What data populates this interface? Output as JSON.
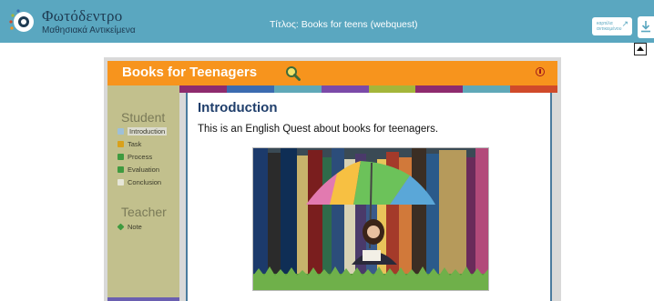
{
  "header": {
    "brand_name": "Φωτόδεντρο",
    "brand_sub": "Μαθησιακά Αντικείμενα",
    "title": "Τίτλος: Books for teens (webquest)",
    "open_button_line1": "καρτέλα",
    "open_button_line2": "αντικειμένου"
  },
  "webquest": {
    "title": "Books for Teenagers",
    "student_heading": "Student",
    "teacher_heading": "Teacher",
    "nav": [
      {
        "label": "Introduction",
        "icon": "page-icon",
        "color": "#9ec0d8"
      },
      {
        "label": "Task",
        "icon": "folder-icon",
        "color": "#d9a11b"
      },
      {
        "label": "Process",
        "icon": "steps-icon",
        "color": "#3f9a3f"
      },
      {
        "label": "Evaluation",
        "icon": "check-icon",
        "color": "#3f9a3f"
      },
      {
        "label": "Conclusion",
        "icon": "pen-icon",
        "color": "#e6e6d8"
      }
    ],
    "teacher_nav": [
      {
        "label": "Note",
        "icon": "diamond-icon",
        "color": "#3f9a3f"
      }
    ],
    "stripe_colors": [
      "#8e2b6e",
      "#3b6bb0",
      "#5fa8b8",
      "#7b4aa8",
      "#a4b63a",
      "#8e2b6e",
      "#5fa8b8",
      "#d04a2a"
    ]
  },
  "content": {
    "heading": "Introduction",
    "text": "This is an English Quest about books for teenagers."
  },
  "colors": {
    "topbar": "#5aa7c0",
    "header_orange": "#f7941d",
    "sidebar": "#c2c08d",
    "heading_blue": "#1f3e6b"
  }
}
